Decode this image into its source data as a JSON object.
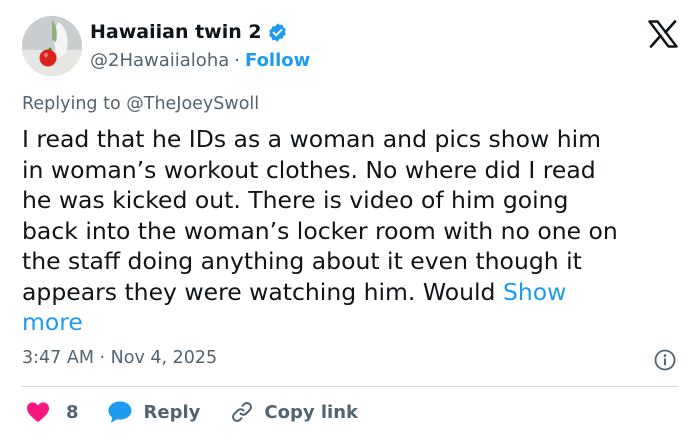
{
  "author": {
    "display_name": "Hawaiian twin 2",
    "handle": "@2Hawaiialoha",
    "separator": "·",
    "follow_label": "Follow",
    "verified_icon": "verified-badge-icon",
    "verified_color": "#1d9bf0"
  },
  "reply_context": {
    "prefix": "Replying to",
    "mention": "@TheJoeySwoll"
  },
  "post": {
    "lines": [
      "I read that he IDs as a woman and pics show him",
      "in woman’s workout clothes. No where did I read",
      "he was kicked out. There is video of him going",
      "back into the woman’s locker room with no one on",
      "the staff doing anything about it even though it",
      "appears they were watching  him. Would "
    ],
    "show_more_part1": "Show",
    "show_more_part2": "more"
  },
  "meta": {
    "time": "3:47 AM",
    "separator": "·",
    "date": "Nov 4, 2025"
  },
  "actions": {
    "like_count": "8",
    "reply_label": "Reply",
    "copy_label": "Copy link"
  },
  "colors": {
    "accent": "#1d9bf0",
    "like": "#f91880",
    "muted": "#536471",
    "text": "#0f1419"
  },
  "icons": {
    "logo": "x-logo-icon",
    "info": "info-icon",
    "like": "heart-icon",
    "reply": "chat-bubble-icon",
    "copy": "link-icon"
  }
}
